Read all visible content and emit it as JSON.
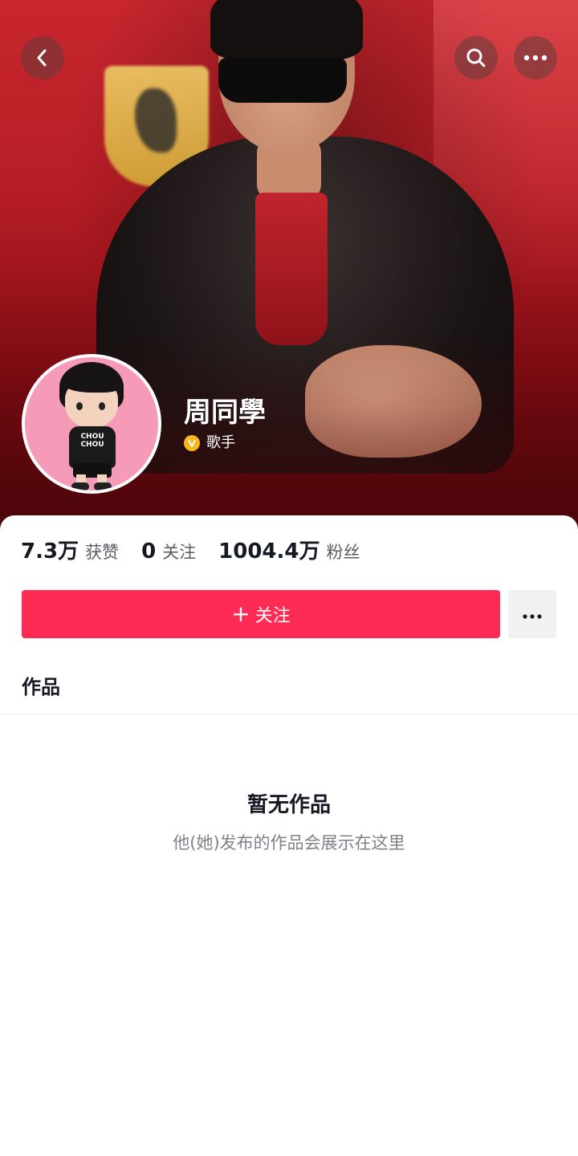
{
  "profile": {
    "name": "周同學",
    "verify_label": "歌手",
    "avatar_text": "CHOU CHOU"
  },
  "stats": [
    {
      "value": "7.3万",
      "label": "获赞"
    },
    {
      "value": "0",
      "label": "关注"
    },
    {
      "value": "1004.4万",
      "label": "粉丝"
    }
  ],
  "actions": {
    "follow_plus": "+",
    "follow_label": "关注"
  },
  "tabs": {
    "works_label": "作品"
  },
  "empty_state": {
    "title": "暂无作品",
    "subtitle": "他(她)发布的作品会展示在这里"
  },
  "icons": {
    "back": "chevron-left-icon",
    "search": "search-icon",
    "more": "more-horizontal-icon",
    "verify": "verified-v-icon"
  },
  "colors": {
    "accent": "#fe2c55",
    "verify": "#f6b81a",
    "cover": "#b81d25"
  }
}
